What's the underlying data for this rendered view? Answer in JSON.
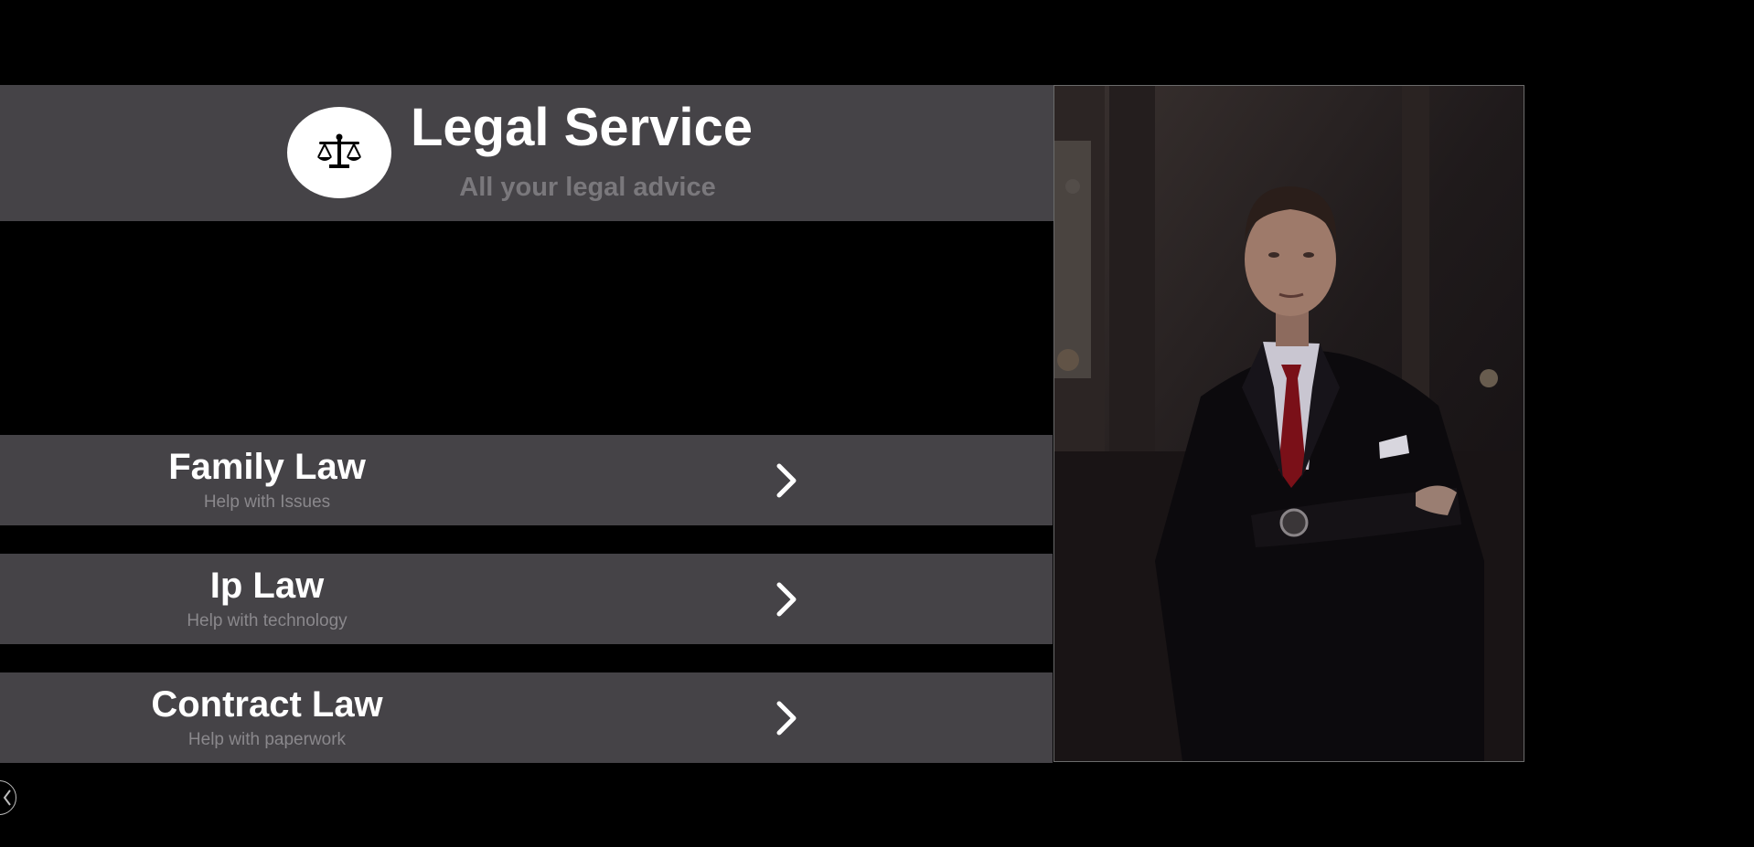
{
  "header": {
    "title": "Legal Service",
    "subtitle": "All your legal advice",
    "logo_icon": "scales-of-justice-icon"
  },
  "services": [
    {
      "title": "Family Law",
      "subtitle": "Help with Issues",
      "icon": "chevron-right-icon"
    },
    {
      "title": "Ip Law",
      "subtitle": "Help with technology",
      "icon": "chevron-right-icon"
    },
    {
      "title": "Contract Law",
      "subtitle": "Help with paperwork",
      "icon": "chevron-right-icon"
    }
  ],
  "photo": {
    "description": "man in dark suit with red tie, arms crossed"
  },
  "corner_button": {
    "icon": "chevron-left-icon"
  },
  "colors": {
    "background": "#000000",
    "panel": "#454347",
    "title_text": "#ffffff",
    "subtitle_text": "#7a787c"
  }
}
